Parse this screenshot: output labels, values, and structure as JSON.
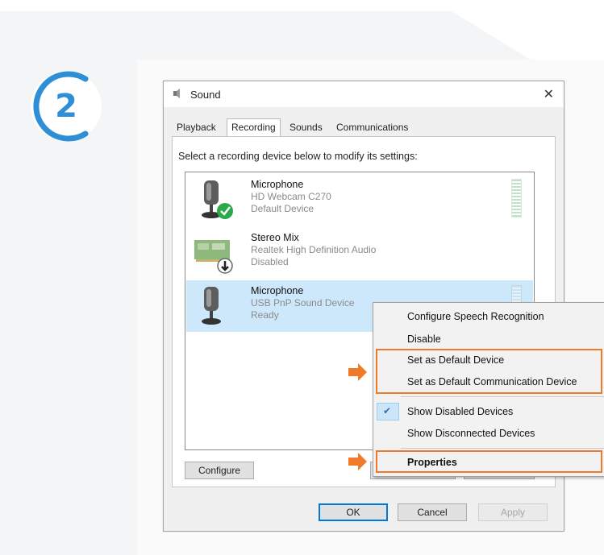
{
  "step": {
    "number": "2"
  },
  "dialog": {
    "title": "Sound",
    "tabs": [
      "Playback",
      "Recording",
      "Sounds",
      "Communications"
    ],
    "active_tab": "Recording",
    "instruction": "Select a recording device below to modify its settings:",
    "devices": [
      {
        "name": "Microphone",
        "sub": "HD Webcam C270",
        "status": "Default Device",
        "selected": false
      },
      {
        "name": "Stereo Mix",
        "sub": "Realtek High Definition Audio",
        "status": "Disabled",
        "selected": false
      },
      {
        "name": "Microphone",
        "sub": "USB PnP Sound Device",
        "status": "Ready",
        "selected": true
      }
    ],
    "buttons": {
      "configure": "Configure",
      "ok": "OK",
      "cancel": "Cancel",
      "apply": "Apply"
    }
  },
  "context_menu": {
    "items": [
      {
        "label": "Configure Speech Recognition",
        "checked": false,
        "bold": false,
        "highlight": false
      },
      {
        "label": "Disable",
        "checked": false,
        "bold": false,
        "highlight": false
      },
      {
        "label": "Set as Default Device",
        "checked": false,
        "bold": false,
        "highlight": true
      },
      {
        "label": "Set as Default Communication Device",
        "checked": false,
        "bold": false,
        "highlight": true
      },
      {
        "label": "Show Disabled Devices",
        "checked": true,
        "bold": false,
        "highlight": false
      },
      {
        "label": "Show Disconnected Devices",
        "checked": false,
        "bold": false,
        "highlight": false
      },
      {
        "label": "Properties",
        "checked": false,
        "bold": true,
        "highlight": true
      }
    ]
  },
  "colors": {
    "accent": "#f07a2a",
    "badge": "#2e8fd6",
    "selection": "#cde8fb"
  }
}
